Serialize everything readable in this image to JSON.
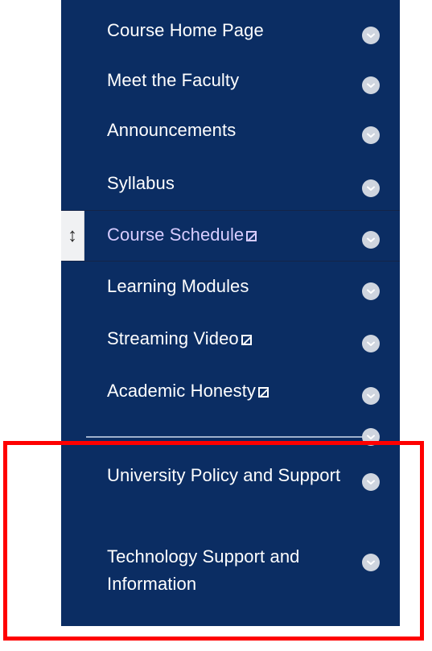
{
  "menu": {
    "items": [
      {
        "label": "Course Home Page",
        "hidden": false
      },
      {
        "label": "Meet the Faculty",
        "hidden": false
      },
      {
        "label": "Announcements",
        "hidden": false
      },
      {
        "label": "Syllabus",
        "hidden": false
      },
      {
        "label": "Course Schedule",
        "hidden": true
      },
      {
        "label": "Learning Modules",
        "hidden": false
      },
      {
        "label": "Streaming Video",
        "hidden": true
      },
      {
        "label": "Academic Honesty",
        "hidden": true
      },
      {
        "label": "University Policy and Support",
        "hidden": false
      },
      {
        "label": "Technology Support and Information",
        "hidden": false
      }
    ]
  },
  "icons": {
    "toggle": "chevron-down-icon",
    "drag": "drag-handle-icon",
    "hidden": "hidden-from-students-icon"
  },
  "colors": {
    "menu_bg": "#0b2d63",
    "text": "#ffffff",
    "active_text": "#d7ccff",
    "toggle_bg": "#cfd5df",
    "highlight": "#ff0000"
  },
  "drag_handle_glyph": "↕"
}
